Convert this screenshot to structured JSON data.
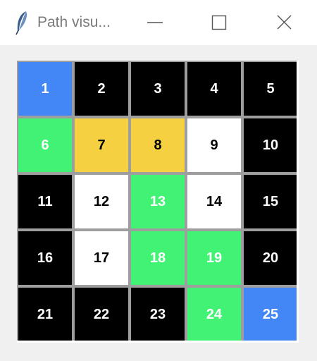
{
  "window": {
    "title": "Path visu...",
    "icon": "feather-icon",
    "controls": [
      "minimize",
      "maximize",
      "close"
    ]
  },
  "colors": {
    "blue": "#4287f5",
    "green": "#42f274",
    "yellow": "#f5d142",
    "black": "#000000",
    "white": "#ffffff",
    "text_dark": "#000000",
    "text_light": "#ffffff"
  },
  "grid": {
    "rows": 5,
    "cols": 5,
    "cells": [
      {
        "label": "1",
        "color": "blue"
      },
      {
        "label": "2",
        "color": "black"
      },
      {
        "label": "3",
        "color": "black"
      },
      {
        "label": "4",
        "color": "black"
      },
      {
        "label": "5",
        "color": "black"
      },
      {
        "label": "6",
        "color": "green"
      },
      {
        "label": "7",
        "color": "yellow"
      },
      {
        "label": "8",
        "color": "yellow"
      },
      {
        "label": "9",
        "color": "white"
      },
      {
        "label": "10",
        "color": "black"
      },
      {
        "label": "11",
        "color": "black"
      },
      {
        "label": "12",
        "color": "white"
      },
      {
        "label": "13",
        "color": "green"
      },
      {
        "label": "14",
        "color": "white"
      },
      {
        "label": "15",
        "color": "black"
      },
      {
        "label": "16",
        "color": "black"
      },
      {
        "label": "17",
        "color": "white"
      },
      {
        "label": "18",
        "color": "green"
      },
      {
        "label": "19",
        "color": "green"
      },
      {
        "label": "20",
        "color": "black"
      },
      {
        "label": "21",
        "color": "black"
      },
      {
        "label": "22",
        "color": "black"
      },
      {
        "label": "23",
        "color": "black"
      },
      {
        "label": "24",
        "color": "green"
      },
      {
        "label": "25",
        "color": "blue"
      }
    ]
  }
}
